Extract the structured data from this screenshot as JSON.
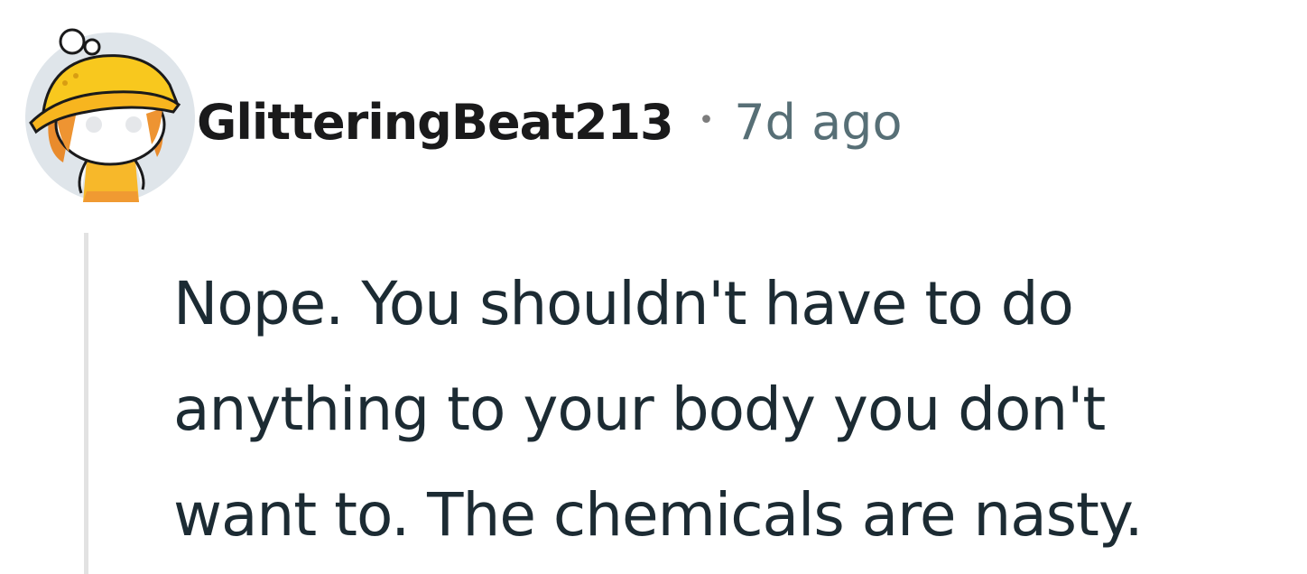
{
  "comment": {
    "author": {
      "username": "GlitteringBeat213",
      "avatar_icon": "snoo-avatar-yellow-bucket-hat-icon"
    },
    "separator": "•",
    "timestamp": "7d ago",
    "body_lines": [
      "Nope. You shouldn't have to do",
      "anything to your body you don't",
      "want to. The chemicals are nasty."
    ]
  },
  "colors": {
    "username": "#1a1a1b",
    "timestamp": "#576f76",
    "body_text": "#1c2b33",
    "thread_line": "#e2e2e2",
    "avatar_background": "#dfe5ea",
    "hat": "#f8c81e"
  }
}
